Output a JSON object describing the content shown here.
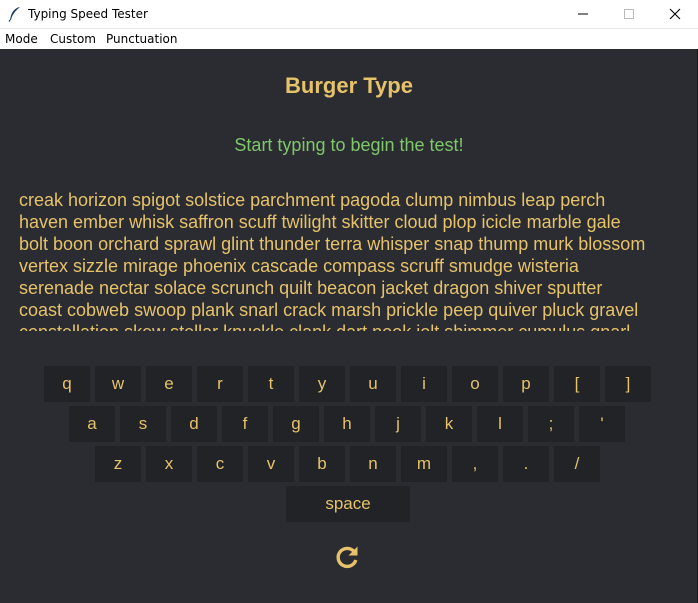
{
  "window": {
    "title": "Typing Speed Tester"
  },
  "menu": {
    "items": [
      "Mode",
      "Custom",
      "Punctuation"
    ]
  },
  "app": {
    "heading": "Burger Type",
    "status": "Start typing to begin the test!",
    "word_lines": [
      "creak horizon spigot solstice parchment pagoda clump nimbus leap perch",
      "haven ember whisk saffron scuff twilight skitter cloud plop icicle marble gale",
      "bolt boon orchard sprawl glint thunder terra whisper snap thump murk blossom",
      "vertex sizzle mirage phoenix cascade compass scruff smudge wisteria",
      "serenade nectar solace scrunch quilt beacon jacket dragon shiver sputter",
      "coast cobweb swoop plank snarl crack marsh prickle peep quiver pluck gravel",
      "constellation skew stellar knuckle clank dart nook jolt shimmer cumulus gnarl"
    ]
  },
  "keyboard": {
    "row1": [
      "q",
      "w",
      "e",
      "r",
      "t",
      "y",
      "u",
      "i",
      "o",
      "p",
      "[",
      "]"
    ],
    "row2": [
      "a",
      "s",
      "d",
      "f",
      "g",
      "h",
      "j",
      "k",
      "l",
      ";",
      "'"
    ],
    "row3": [
      "z",
      "x",
      "c",
      "v",
      "b",
      "n",
      "m",
      ",",
      ".",
      "/"
    ],
    "space": "space"
  },
  "icons": {
    "app": "feather-icon",
    "restart": "restart-icon",
    "minimize": "minimize-icon",
    "maximize": "maximize-icon",
    "close": "close-icon"
  },
  "colors": {
    "background": "#2b2c31",
    "accent": "#e6c26b",
    "status": "#7ec86b",
    "key_bg": "#222327"
  }
}
